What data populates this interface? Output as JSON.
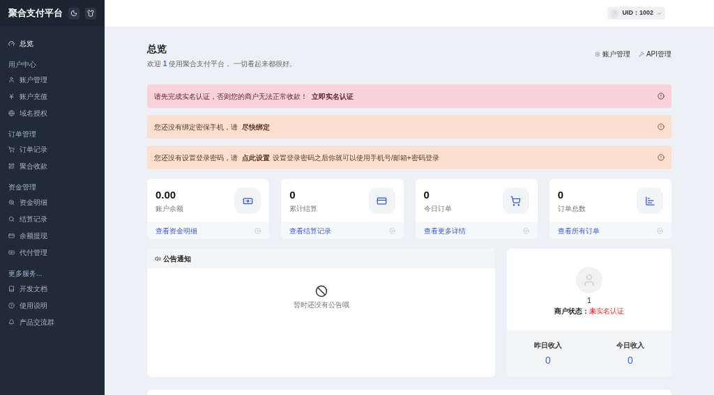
{
  "sidebar": {
    "brand": "聚合支付平台",
    "sections": [
      {
        "items": [
          {
            "label": "总览",
            "selected": true
          }
        ]
      },
      {
        "title": "用户中心",
        "items": [
          {
            "label": "账户管理",
            "selected": false
          },
          {
            "label": "账户充值",
            "selected": false
          },
          {
            "label": "域名授权",
            "selected": false
          }
        ]
      },
      {
        "title": "订单管理",
        "items": [
          {
            "label": "订单记录",
            "selected": false
          },
          {
            "label": "聚合收款",
            "selected": false
          }
        ]
      },
      {
        "title": "资金管理",
        "items": [
          {
            "label": "资金明细",
            "selected": false
          },
          {
            "label": "结算记录",
            "selected": false
          },
          {
            "label": "余额提现",
            "selected": false
          },
          {
            "label": "代付管理",
            "selected": false
          }
        ]
      },
      {
        "title": "更多服务...",
        "items": [
          {
            "label": "开发文档",
            "selected": false
          },
          {
            "label": "使用说明",
            "selected": false
          },
          {
            "label": "产品交流群",
            "selected": false
          }
        ]
      }
    ]
  },
  "header": {
    "user": "UID：1002"
  },
  "page": {
    "title": "总览",
    "welcome": "欢迎 **1** 使用聚合支付平台， 一切看起来都很好。",
    "links": [
      "账户管理",
      "API管理"
    ]
  },
  "alerts": [
    {
      "kind": "danger",
      "text": "请先完成实名认证，否则您的商户无法正常收款！",
      "link": "立即实名认证"
    },
    {
      "kind": "warning",
      "text": "您还没有绑定密保手机，请",
      "link": "尽快绑定"
    },
    {
      "kind": "warning",
      "text": "您还没有设置登录密码，请",
      "link": "点此设置",
      "after": "设置登录密码之后你就可以使用手机号/邮箱+密码登录"
    }
  ],
  "stats": [
    {
      "value": "0.00",
      "label": "账户余额",
      "link": "查看资金明细"
    },
    {
      "value": "0",
      "label": "累计结算",
      "link": "查看结算记录"
    },
    {
      "value": "0",
      "label": "今日订单",
      "link": "查看更多详情"
    },
    {
      "value": "0",
      "label": "订单总数",
      "link": "查看所有订单"
    }
  ],
  "notice": {
    "title": "公告通知",
    "empty": "暂时还没有公告哦"
  },
  "merchant": {
    "uid": "1",
    "status_label": "商户状态：",
    "status": "**未**实名认证",
    "income": [
      {
        "label": "昨日收入",
        "value": "0"
      },
      {
        "label": "今日收入",
        "value": "0"
      }
    ]
  }
}
